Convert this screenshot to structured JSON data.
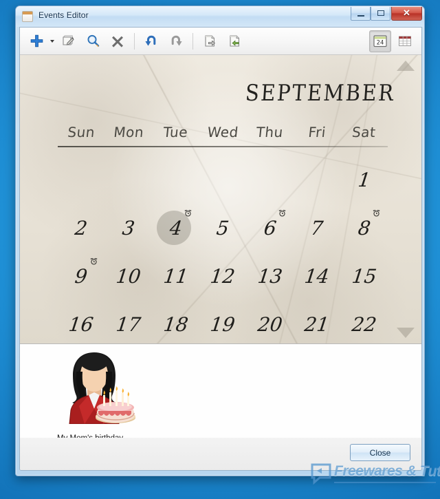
{
  "window": {
    "title": "Events Editor",
    "title_icon": "calendar-app-icon",
    "controls": {
      "minimize": "—",
      "maximize": "□",
      "close": "✕"
    }
  },
  "toolbar": {
    "buttons": [
      {
        "name": "add-event-button",
        "icon": "plus-icon",
        "label": "Add"
      },
      {
        "name": "add-event-dropdown",
        "icon": "chevron-down-icon",
        "label": "Add options"
      },
      {
        "name": "edit-event-button",
        "icon": "edit-note-icon",
        "label": "Edit"
      },
      {
        "name": "search-button",
        "icon": "magnifier-icon",
        "label": "Search"
      },
      {
        "name": "delete-event-button",
        "icon": "x-cross-icon",
        "label": "Delete"
      },
      {
        "name": "undo-button",
        "icon": "undo-arrow-icon",
        "label": "Undo"
      },
      {
        "name": "redo-button",
        "icon": "redo-arrow-icon",
        "label": "Redo"
      },
      {
        "name": "import-button",
        "icon": "document-out-icon",
        "label": "Import"
      },
      {
        "name": "export-button",
        "icon": "document-in-icon",
        "label": "Export"
      }
    ],
    "view_buttons": [
      {
        "name": "calendar-view-button",
        "icon": "calendar-24-icon",
        "label": "Calendar view",
        "number": "24",
        "pressed": true
      },
      {
        "name": "list-view-button",
        "icon": "table-grid-icon",
        "label": "List view",
        "pressed": false
      }
    ]
  },
  "calendar": {
    "month": "SEPTEMBER",
    "scroll_up_icon": "triangle-up-icon",
    "scroll_down_icon": "triangle-down-icon",
    "day_headers": [
      "Sun",
      "Mon",
      "Tue",
      "Wed",
      "Thu",
      "Fri",
      "Sat"
    ],
    "selected_day": 4,
    "event_icon": "alarm-clock-icon",
    "weeks": [
      [
        {
          "day": "",
          "event": false,
          "selected": false
        },
        {
          "day": "",
          "event": false,
          "selected": false
        },
        {
          "day": "",
          "event": false,
          "selected": false
        },
        {
          "day": "",
          "event": false,
          "selected": false
        },
        {
          "day": "",
          "event": false,
          "selected": false
        },
        {
          "day": "",
          "event": false,
          "selected": false
        },
        {
          "day": "1",
          "event": false,
          "selected": false
        }
      ],
      [
        {
          "day": "2",
          "event": false,
          "selected": false
        },
        {
          "day": "3",
          "event": false,
          "selected": false
        },
        {
          "day": "4",
          "event": true,
          "selected": true
        },
        {
          "day": "5",
          "event": false,
          "selected": false
        },
        {
          "day": "6",
          "event": true,
          "selected": false
        },
        {
          "day": "7",
          "event": false,
          "selected": false
        },
        {
          "day": "8",
          "event": true,
          "selected": false
        }
      ],
      [
        {
          "day": "9",
          "event": true,
          "selected": false
        },
        {
          "day": "10",
          "event": false,
          "selected": false
        },
        {
          "day": "11",
          "event": false,
          "selected": false
        },
        {
          "day": "12",
          "event": false,
          "selected": false
        },
        {
          "day": "13",
          "event": false,
          "selected": false
        },
        {
          "day": "14",
          "event": false,
          "selected": false
        },
        {
          "day": "15",
          "event": false,
          "selected": false
        }
      ],
      [
        {
          "day": "16",
          "event": false,
          "selected": false
        },
        {
          "day": "17",
          "event": false,
          "selected": false
        },
        {
          "day": "18",
          "event": false,
          "selected": false
        },
        {
          "day": "19",
          "event": false,
          "selected": false
        },
        {
          "day": "20",
          "event": false,
          "selected": false
        },
        {
          "day": "21",
          "event": false,
          "selected": false
        },
        {
          "day": "22",
          "event": false,
          "selected": false
        }
      ]
    ]
  },
  "details": {
    "event": {
      "caption": "My Mom's birthday",
      "avatar": "woman-with-birthday-cake-avatar"
    }
  },
  "footer": {
    "close_label": "Close"
  },
  "watermark": {
    "text": "Freewares & Tutos",
    "icon": "speech-bubble-logo"
  },
  "colors": {
    "desktop": "#1e8ed4",
    "accent_blue": "#3a7fc4",
    "close_red": "#b93227",
    "parchment": "#e7e1d5",
    "selected_day_circle": "#78746a",
    "watermark_blue": "#5496cd"
  }
}
